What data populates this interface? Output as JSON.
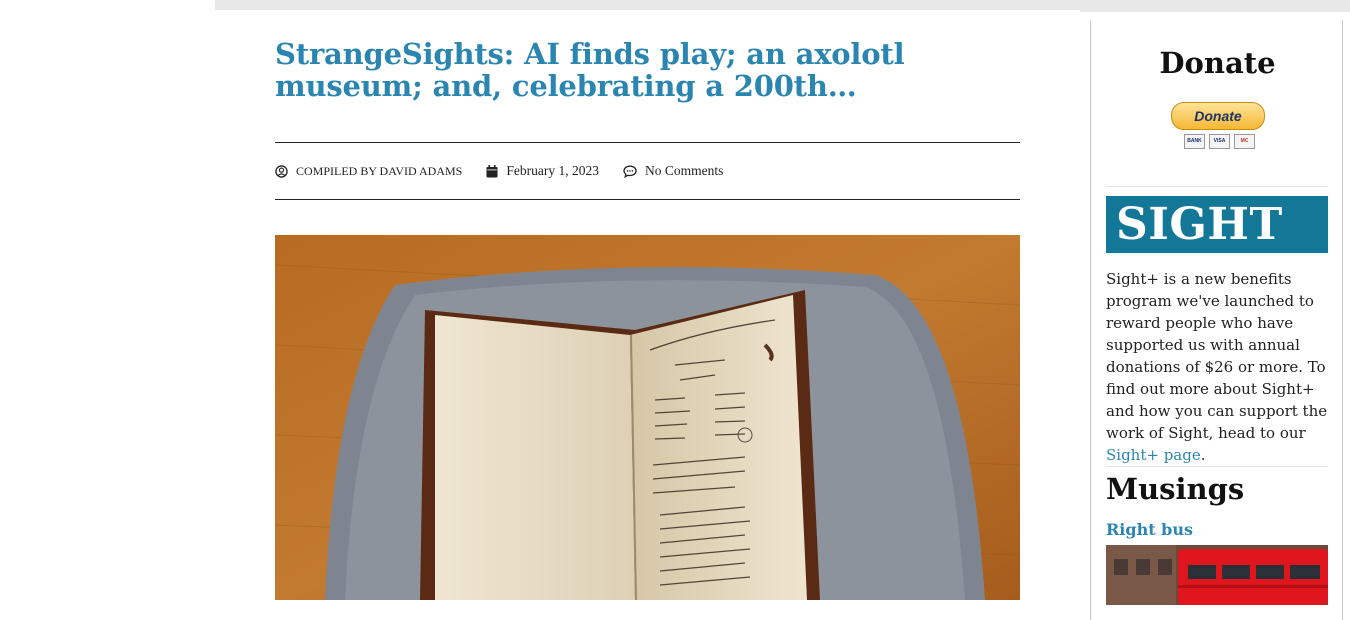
{
  "article": {
    "title": "StrangeSights: AI finds play; an axolotl museum; and, celebrating a 200th…",
    "author": "COMPILED BY DAVID ADAMS",
    "date": "February 1, 2023",
    "comments": "No Comments"
  },
  "sidebar": {
    "donate": {
      "title": "Donate",
      "button_label": "Donate",
      "cards": [
        "BANK",
        "VISA",
        "MC"
      ]
    },
    "sight_plus": {
      "banner_text": "SIGHT +",
      "text_before_link": "Sight+ is a new benefits program we've launched to reward people who have supported us with annual donations of $26 or more. To find out more about Sight+ and how you can support the work of Sight, head to our ",
      "link_label": "Sight+ page",
      "text_after_link": "."
    },
    "musings": {
      "title": "Musings",
      "post_title": "Right bus"
    }
  },
  "colors": {
    "link": "#2a86b0",
    "sight_banner": "#137898",
    "bus_red": "#e0161e"
  }
}
